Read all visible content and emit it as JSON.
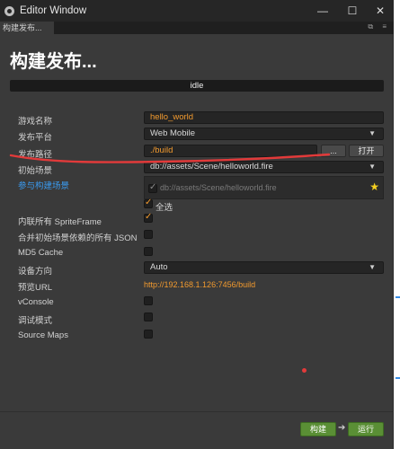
{
  "window": {
    "title": "Editor Window",
    "tab_label": "构建发布...",
    "tab_icons": "⧉ ≡"
  },
  "heading": "构建发布...",
  "status": "idle",
  "form": {
    "game_name_label": "游戏名称",
    "game_name_value": "hello_world",
    "platform_label": "发布平台",
    "platform_value": "Web Mobile",
    "build_path_label": "发布路径",
    "build_path_value": "./build",
    "browse_button": "...",
    "open_button": "打开",
    "start_scene_label": "初始场景",
    "start_scene_value": "db://assets/Scene/helloworld.fire",
    "scenes_label": "参与构建场景",
    "scenes": [
      {
        "path": "db://assets/Scene/helloworld.fire",
        "checked": true
      }
    ],
    "select_all_label": "全选",
    "inline_spriteframe_label": "内联所有 SpriteFrame",
    "merge_json_label": "合并初始场景依赖的所有 JSON",
    "md5_label": "MD5 Cache",
    "orientation_label": "设备方向",
    "orientation_value": "Auto",
    "preview_url_label": "预览URL",
    "preview_url_value": "http://192.168.1.126:7456/build",
    "vconsole_label": "vConsole",
    "debug_label": "调试模式",
    "sourcemaps_label": "Source Maps"
  },
  "footer": {
    "build_button": "构建",
    "run_button": "运行"
  },
  "colors": {
    "accent_orange": "#f29a2e",
    "link_blue": "#3a9bf0",
    "build_green": "#5a8f35",
    "annotation_red": "#e23a3a"
  }
}
